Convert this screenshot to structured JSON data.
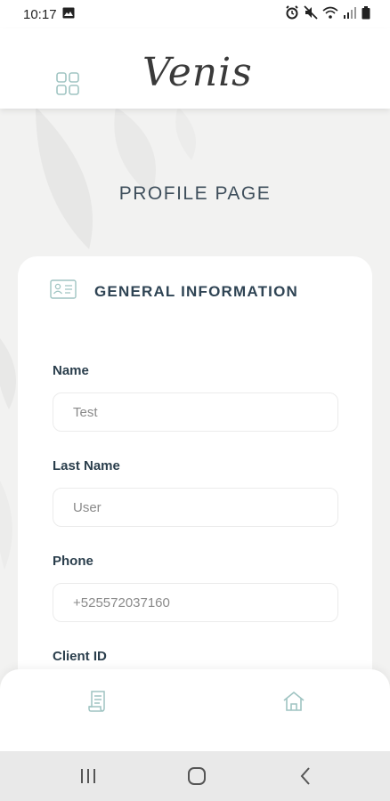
{
  "status_bar": {
    "time": "10:17",
    "icons": [
      "gallery-icon",
      "alarm-icon",
      "mute-icon",
      "wifi-icon",
      "signal-icon",
      "battery-icon"
    ]
  },
  "header": {
    "logo_text": "Venis",
    "menu_icon": "grid-icon"
  },
  "page": {
    "title": "PROFILE PAGE"
  },
  "general_info": {
    "heading": "GENERAL INFORMATION",
    "heading_icon": "id-card-icon",
    "fields": [
      {
        "label": "Name",
        "value": "Test"
      },
      {
        "label": "Last Name",
        "value": "User"
      },
      {
        "label": "Phone",
        "value": "+525572037160"
      },
      {
        "label": "Client ID",
        "value": ""
      }
    ]
  },
  "bottom_nav": {
    "items": [
      {
        "icon": "document-icon"
      },
      {
        "icon": "home-icon"
      }
    ]
  },
  "system_nav": {
    "buttons": [
      "recents",
      "home",
      "back"
    ]
  },
  "colors": {
    "accent": "#9fc4c2",
    "heading_text": "#2f4454",
    "background": "#f2f2f1"
  }
}
